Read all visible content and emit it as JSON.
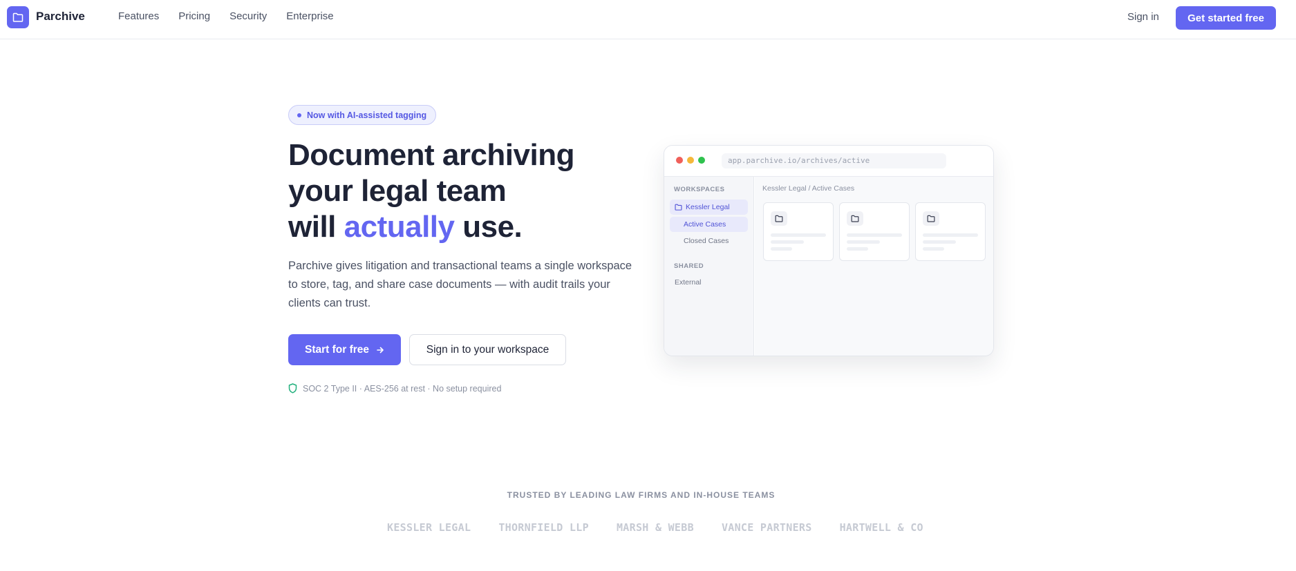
{
  "brand": {
    "name": "Parchive",
    "color": "#6366f1"
  },
  "nav": {
    "links": [
      "Features",
      "Pricing",
      "Security",
      "Enterprise"
    ],
    "signin": "Sign in",
    "cta": "Get started free"
  },
  "hero": {
    "badge": "Now with AI-assisted tagging",
    "headline_line1": "Document archiving",
    "headline_line2": "your legal team",
    "headline_line3_pre": "will ",
    "headline_line3_accent": "actually",
    "headline_line3_post": " use.",
    "lede": "Parchive gives litigation and transactional teams a single workspace to store, tag, and share case documents — with audit trails your clients can trust.",
    "primary_cta": "Start for free",
    "secondary_cta": "Sign in to your workspace",
    "trust_line": "SOC 2 Type II · AES-256 at rest · No setup required"
  },
  "mockup": {
    "url": "app.parchive.io/archives/active",
    "workspaces_label": "WORKSPACES",
    "workspace_name": "Kessler Legal",
    "items": [
      "Active Cases",
      "Closed Cases"
    ],
    "shared_label": "SHARED",
    "shared_items": [
      "External"
    ],
    "breadcrumb": "Kessler Legal / Active Cases"
  },
  "social_proof": {
    "label": "TRUSTED BY LEADING LAW FIRMS AND IN-HOUSE TEAMS",
    "firms": [
      "KESSLER LEGAL",
      "THORNFIELD LLP",
      "MARSH & WEBB",
      "VANCE PARTNERS",
      "HARTWELL & CO"
    ]
  }
}
